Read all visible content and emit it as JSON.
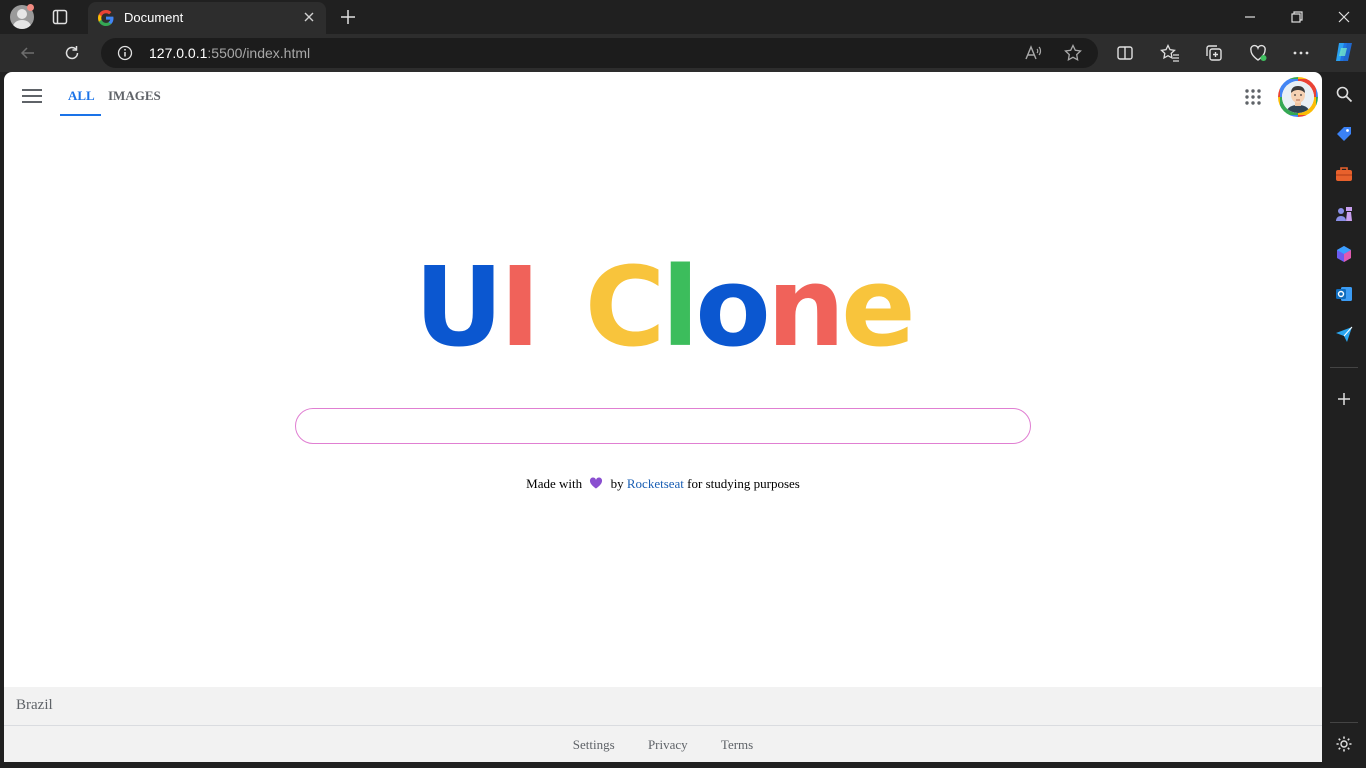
{
  "browser": {
    "tab": {
      "title": "Document"
    },
    "address": {
      "host": "127.0.0.1",
      "path": ":5500/index.html"
    }
  },
  "page": {
    "tabs": [
      {
        "label": "ALL",
        "active": true
      },
      {
        "label": "IMAGES",
        "active": false
      }
    ],
    "logo": {
      "letters": [
        {
          "char": "U",
          "color": "#0b57d0"
        },
        {
          "char": "I",
          "color": "#f0625a"
        },
        {
          "char": " ",
          "color": "#000000"
        },
        {
          "char": "C",
          "color": "#f8c43c"
        },
        {
          "char": "l",
          "color": "#3cbd5c"
        },
        {
          "char": "o",
          "color": "#0b57d0"
        },
        {
          "char": "n",
          "color": "#f0625a"
        },
        {
          "char": "e",
          "color": "#f8c43c"
        }
      ]
    },
    "search": {
      "placeholder": "",
      "value": ""
    },
    "credit": {
      "prefix": "Made with",
      "by": "by",
      "link": "Rocketseat",
      "suffix": "for studying purposes"
    },
    "footer": {
      "country": "Brazil",
      "links": [
        "Settings",
        "Privacy",
        "Terms"
      ]
    }
  }
}
